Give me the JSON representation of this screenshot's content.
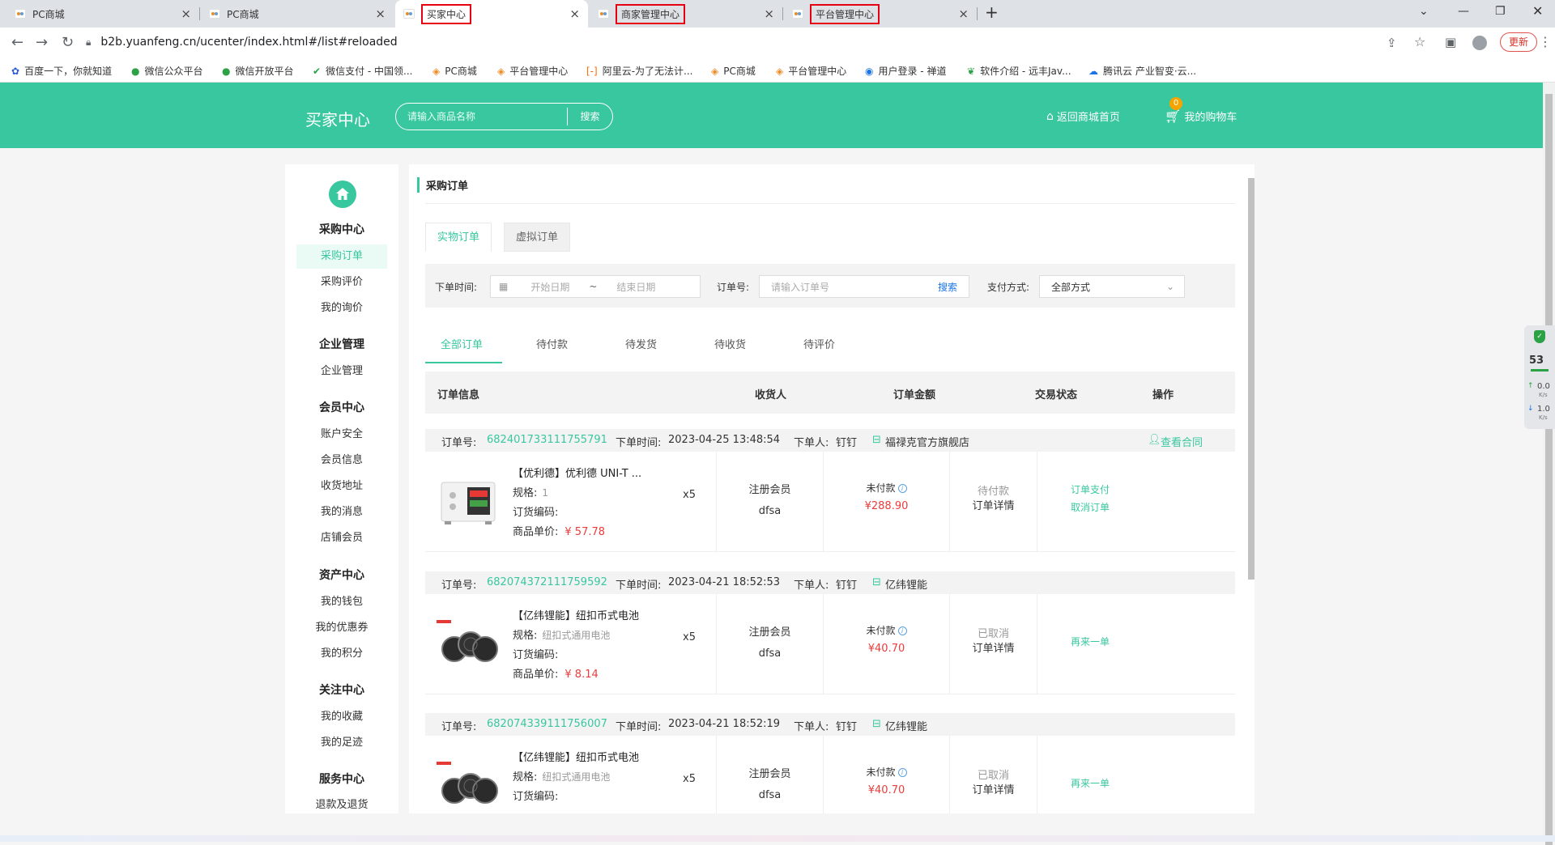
{
  "browser": {
    "tabs": [
      {
        "label": "PC商城",
        "active": false,
        "highlighted": false
      },
      {
        "label": "PC商城",
        "active": false,
        "highlighted": false
      },
      {
        "label": "买家中心",
        "active": true,
        "highlighted": true
      },
      {
        "label": "商家管理中心",
        "active": false,
        "highlighted": true
      },
      {
        "label": "平台管理中心",
        "active": false,
        "highlighted": true
      }
    ],
    "url": "b2b.yuanfeng.cn/ucenter/index.html#/list#reloaded",
    "update_label": "更新",
    "bookmarks": [
      "百度一下，你就知道",
      "微信公众平台",
      "微信开放平台",
      "微信支付 - 中国领...",
      "PC商城",
      "平台管理中心",
      "阿里云-为了无法计...",
      "PC商城",
      "平台管理中心",
      "用户登录 - 禅道",
      "软件介绍 - 远丰Jav...",
      "腾讯云 产业智变·云..."
    ]
  },
  "header": {
    "logo": "买家中心",
    "search_placeholder": "请输入商品名称",
    "search_button": "搜索",
    "home_link": "返回商城首页",
    "cart_link": "我的购物车",
    "cart_count": "0"
  },
  "sidebar": {
    "groups": [
      {
        "title": "采购中心",
        "items": [
          "采购订单",
          "采购评价",
          "我的询价"
        ]
      },
      {
        "title": "企业管理",
        "items": [
          "企业管理"
        ]
      },
      {
        "title": "会员中心",
        "items": [
          "账户安全",
          "会员信息",
          "收货地址",
          "我的消息",
          "店铺会员"
        ]
      },
      {
        "title": "资产中心",
        "items": [
          "我的钱包",
          "我的优惠券",
          "我的积分"
        ]
      },
      {
        "title": "关注中心",
        "items": [
          "我的收藏",
          "我的足迹"
        ]
      },
      {
        "title": "服务中心",
        "items": [
          "退款及退货"
        ]
      }
    ],
    "active_item": "采购订单"
  },
  "main": {
    "title": "采购订单",
    "type_tabs": [
      "实物订单",
      "虚拟订单"
    ],
    "filter": {
      "date_label": "下单时间:",
      "start_placeholder": "开始日期",
      "date_sep": "~",
      "end_placeholder": "结束日期",
      "order_label": "订单号:",
      "order_placeholder": "请输入订单号",
      "search_button": "搜索",
      "pay_label": "支付方式:",
      "pay_value": "全部方式"
    },
    "status_tabs": [
      "全部订单",
      "待付款",
      "待发货",
      "待收货",
      "待评价"
    ],
    "columns": [
      "订单信息",
      "收货人",
      "订单金额",
      "交易状态",
      "操作"
    ],
    "order_labels": {
      "order_no": "订单号:",
      "order_time": "下单时间:",
      "buyer": "下单人:",
      "spec": "规格:",
      "code": "订货编码:",
      "unit_price": "商品单价:"
    },
    "orders": [
      {
        "order_no": "682401733111755791",
        "time": "2023-04-25 13:48:54",
        "buyer": "钉钉",
        "shop": "福禄克官方旗舰店",
        "contract": "查看合同",
        "product": "【优利德】优利德 UNI-T ...",
        "spec": "1",
        "price": "¥ 57.78",
        "qty": "x5",
        "receiver_type": "注册会员",
        "receiver": "dfsa",
        "pay_status": "未付款",
        "amount": "¥288.90",
        "trade_status": "待付款",
        "detail": "订单详情",
        "actions": [
          "订单支付",
          "取消订单"
        ]
      },
      {
        "order_no": "682074372111759592",
        "time": "2023-04-21 18:52:53",
        "buyer": "钉钉",
        "shop": "亿纬锂能",
        "contract": "",
        "product": "【亿纬锂能】纽扣币式电池",
        "spec": "纽扣式通用电池",
        "price": "¥ 8.14",
        "qty": "x5",
        "receiver_type": "注册会员",
        "receiver": "dfsa",
        "pay_status": "未付款",
        "amount": "¥40.70",
        "trade_status": "已取消",
        "detail": "订单详情",
        "actions": [
          "再来一单"
        ]
      },
      {
        "order_no": "682074339111756007",
        "time": "2023-04-21 18:52:19",
        "buyer": "钉钉",
        "shop": "亿纬锂能",
        "contract": "",
        "product": "【亿纬锂能】纽扣币式电池",
        "spec": "纽扣式通用电池",
        "price": "",
        "qty": "x5",
        "receiver_type": "注册会员",
        "receiver": "dfsa",
        "pay_status": "未付款",
        "amount": "¥40.70",
        "trade_status": "已取消",
        "detail": "订单详情",
        "actions": [
          "再来一单"
        ]
      }
    ]
  },
  "widget": {
    "percent": "53",
    "up": "0.0",
    "down": "1.0",
    "unit": "K/s"
  },
  "colors": {
    "accent": "#38c79e",
    "price_red": "#ee3b3b",
    "badge": "#f8a400"
  }
}
